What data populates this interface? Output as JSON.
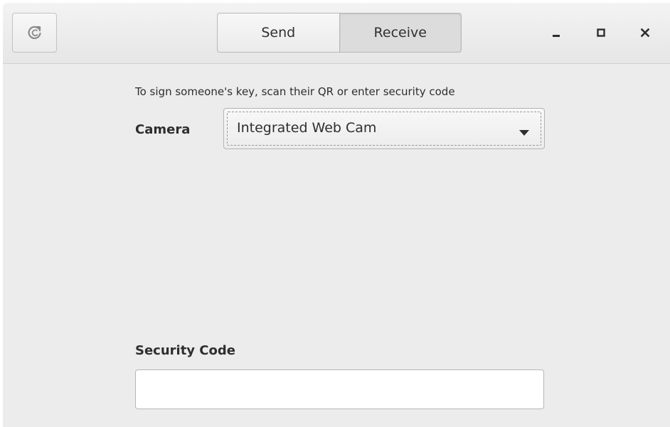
{
  "header": {
    "back_icon": "redo-arrow-icon",
    "tabs": [
      {
        "label": "Send",
        "active": false
      },
      {
        "label": "Receive",
        "active": true
      }
    ],
    "window_controls": {
      "minimize_icon": "minimize-icon",
      "maximize_icon": "maximize-icon",
      "close_icon": "close-icon"
    }
  },
  "main": {
    "instructions": "To sign someone's key, scan their QR or enter security code",
    "camera_label": "Camera",
    "camera_selected": "Integrated Web Cam",
    "camera_dropdown_icon": "dropdown-arrow-icon",
    "security_code_label": "Security Code",
    "security_code_value": ""
  },
  "colors": {
    "window_background": "#ececec",
    "headerbar_background": "#e9e9e9",
    "text": "#2e2e2e"
  }
}
